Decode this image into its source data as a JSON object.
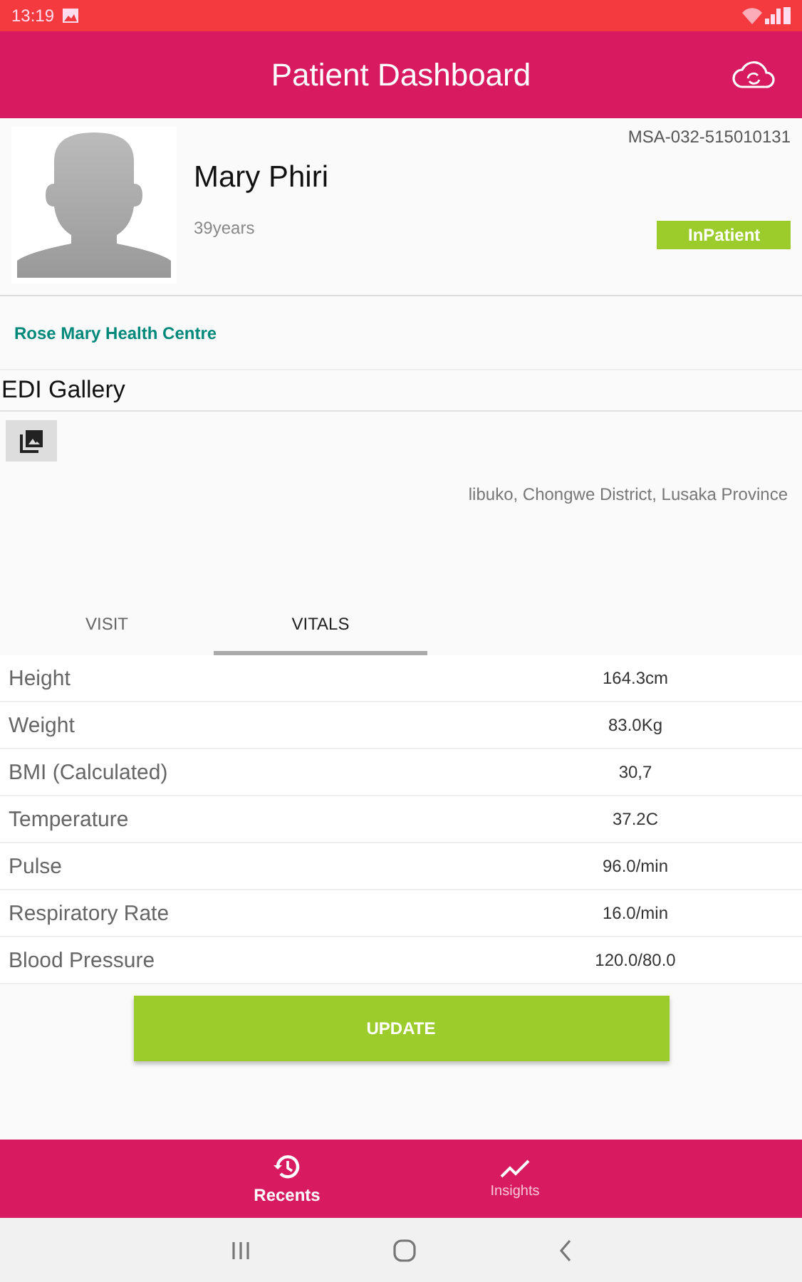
{
  "status_bar": {
    "time": "13:19"
  },
  "app_bar": {
    "title": "Patient Dashboard"
  },
  "patient": {
    "id": "MSA-032-515010131",
    "name": "Mary Phiri",
    "age": "39years",
    "status": "InPatient",
    "facility": "Rose Mary Health Centre"
  },
  "gallery": {
    "title": "EDI Gallery"
  },
  "address": "libuko, Chongwe District, Lusaka Province",
  "tabs": [
    {
      "label": "VISIT",
      "selected": false
    },
    {
      "label": "VITALS",
      "selected": true
    }
  ],
  "vitals": [
    {
      "label": "Height",
      "value": "164.3cm"
    },
    {
      "label": "Weight",
      "value": "83.0Kg"
    },
    {
      "label": "BMI (Calculated)",
      "value": "30,7"
    },
    {
      "label": "Temperature",
      "value": "37.2C"
    },
    {
      "label": "Pulse",
      "value": "96.0/min"
    },
    {
      "label": "Respiratory Rate",
      "value": "16.0/min"
    },
    {
      "label": "Blood Pressure",
      "value": "120.0/80.0"
    }
  ],
  "update_button": "UPDATE",
  "bottom_nav": [
    {
      "label": "Recents",
      "kind": "recents",
      "selected": true
    },
    {
      "label": "Insights",
      "kind": "insights",
      "selected": false
    }
  ]
}
